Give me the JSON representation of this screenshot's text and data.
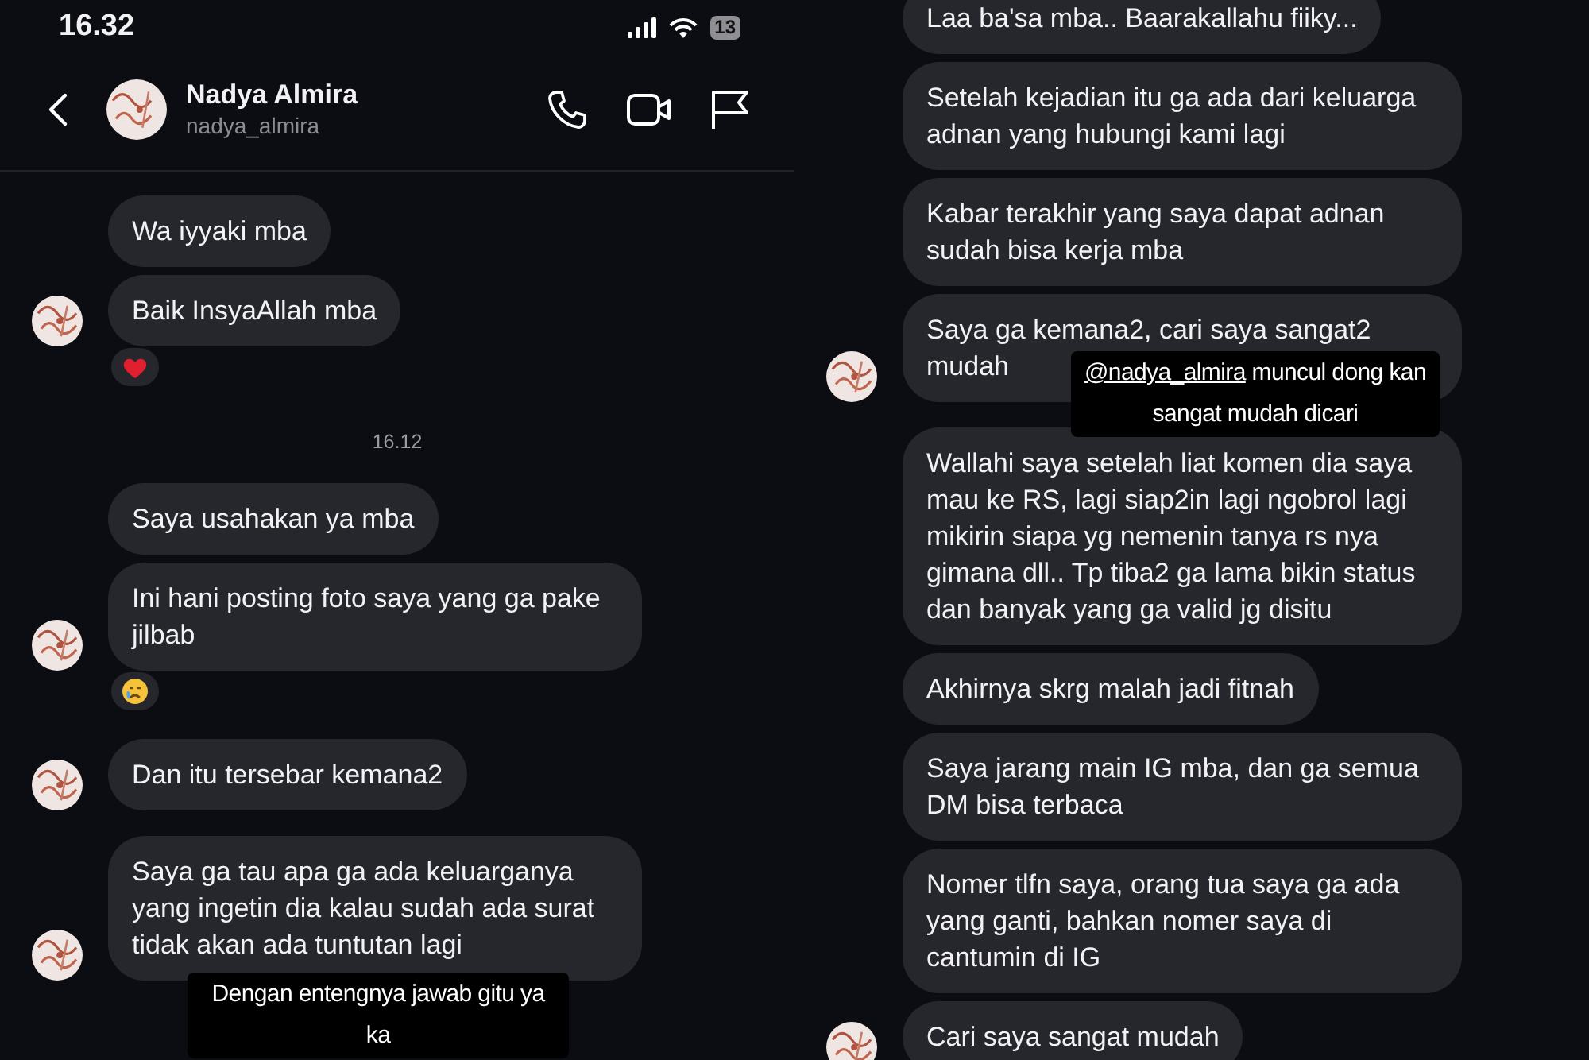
{
  "left": {
    "status_bar": {
      "time": "16.32",
      "battery": "13"
    },
    "header": {
      "name": "Nadya Almira",
      "username": "nadya_almira"
    },
    "messages": [
      {
        "kind": "message",
        "text": "Wa iyyaki mba",
        "avatar": false
      },
      {
        "kind": "message",
        "text": "Baik InsyaAllah mba",
        "avatar": true,
        "reaction": {
          "kind": "heart"
        }
      },
      {
        "kind": "timestamp",
        "text": "16.12"
      },
      {
        "kind": "message",
        "text": "Saya usahakan ya mba",
        "avatar": false
      },
      {
        "kind": "message",
        "text": "Ini hani posting foto saya yang ga pake jilbab",
        "avatar": true,
        "reaction": {
          "kind": "sad"
        }
      },
      {
        "kind": "message",
        "text": "Dan itu tersebar kemana2",
        "avatar": true
      },
      {
        "kind": "message",
        "text": "Saya ga tau apa ga ada keluarganya yang ingetin dia kalau sudah ada surat tidak akan ada tuntutan lagi",
        "avatar": true
      }
    ],
    "caption": {
      "text": "Dengan entengnya jawab gitu ya ka"
    }
  },
  "right": {
    "messages": [
      {
        "kind": "message",
        "text": "Laa ba'sa mba.. Baarakallahu fiiky...",
        "avatar": false
      },
      {
        "kind": "message",
        "text": "Setelah kejadian itu ga ada dari keluarga adnan yang hubungi kami lagi",
        "avatar": false
      },
      {
        "kind": "message",
        "text": "Kabar terakhir yang saya dapat adnan sudah bisa kerja mba",
        "avatar": false
      },
      {
        "kind": "message",
        "text": "Saya ga kemana2, cari saya sangat2 mudah",
        "avatar": true
      },
      {
        "kind": "message",
        "text": "Wallahi saya setelah liat komen dia saya mau ke RS, lagi siap2in lagi ngobrol lagi mikirin siapa yg nemenin tanya rs nya gimana dll.. Tp tiba2 ga lama bikin status dan banyak yang ga valid jg disitu",
        "avatar": false
      },
      {
        "kind": "message",
        "text": "Akhirnya skrg malah jadi fitnah",
        "avatar": false
      },
      {
        "kind": "message",
        "text": "Saya jarang main IG mba, dan ga semua DM bisa terbaca",
        "avatar": false
      },
      {
        "kind": "message",
        "text": "Nomer tlfn saya, orang tua saya ga ada yang ganti, bahkan nomer saya di cantumin di IG",
        "avatar": false
      },
      {
        "kind": "message",
        "text": "Cari saya sangat mudah",
        "avatar": true
      }
    ],
    "caption": {
      "mention": "@nadya_almira",
      "text": "muncul dong kan sangat mudah dicari"
    }
  }
}
